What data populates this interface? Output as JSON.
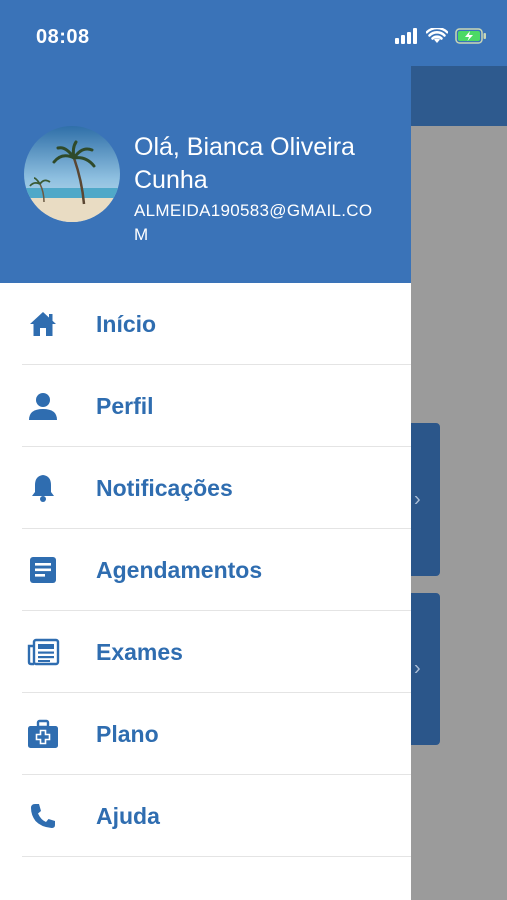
{
  "status_bar": {
    "time": "08:08"
  },
  "drawer": {
    "greeting": "Olá, Bianca Oliveira Cunha",
    "email": "ALMEIDA190583@GMAIL.COM",
    "menu": [
      {
        "label": "Início",
        "icon": "home-icon"
      },
      {
        "label": "Perfil",
        "icon": "person-icon"
      },
      {
        "label": "Notificações",
        "icon": "bell-icon"
      },
      {
        "label": "Agendamentos",
        "icon": "document-icon"
      },
      {
        "label": "Exames",
        "icon": "newspaper-icon"
      },
      {
        "label": "Plano",
        "icon": "medical-kit-icon"
      },
      {
        "label": "Ajuda",
        "icon": "phone-icon"
      }
    ]
  },
  "colors": {
    "brand_blue": "#3a73b8",
    "menu_text": "#2f6db0",
    "dim_overlay": "#9b9b9b"
  }
}
